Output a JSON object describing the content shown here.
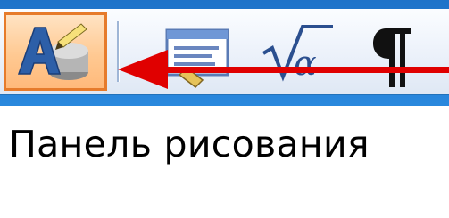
{
  "toolbar": {
    "buttons": [
      {
        "icon": "drawing-icon",
        "state": "pressed"
      },
      {
        "icon": "text-frame-icon"
      },
      {
        "icon": "equation-icon"
      },
      {
        "icon": "pilcrow-icon"
      }
    ]
  },
  "annotation": {
    "arrow_color": "#e00000"
  },
  "caption": {
    "text": "Панель рисования"
  },
  "colors": {
    "background": "#2a83d6",
    "pressed_border": "#e67b2b"
  }
}
